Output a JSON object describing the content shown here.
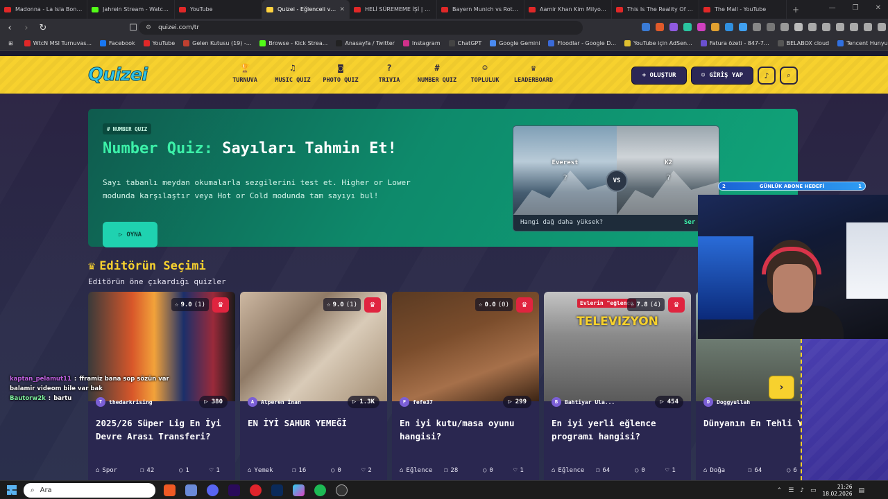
{
  "browser": {
    "tabs": [
      {
        "title": "Madonna - La Isla Bonita",
        "fav": "youtube",
        "active": false
      },
      {
        "title": "Jahrein Stream - Watch Li",
        "fav": "kick",
        "active": false
      },
      {
        "title": "YouTube",
        "fav": "youtube",
        "active": false
      },
      {
        "title": "Quizei - Eğlenceli ve e",
        "fav": "quizei",
        "active": true
      },
      {
        "title": "HELİ SÜREMEME İŞİ | SQU",
        "fav": "youtube",
        "active": false
      },
      {
        "title": "Bayern Munich vs Rottach",
        "fav": "youtube",
        "active": false
      },
      {
        "title": "Aamir Khan Kim Milyoner",
        "fav": "youtube",
        "active": false
      },
      {
        "title": "This Is The Reality Of Mod",
        "fav": "youtube",
        "active": false
      },
      {
        "title": "The Mall - YouTube",
        "fav": "youtube",
        "active": false
      }
    ],
    "url": "quizei.com/tr",
    "bookmarks": [
      "WtcN MSI Turnuvas...",
      "Facebook",
      "YouTube",
      "Gelen Kutusu (19) -...",
      "Browse - Kick Strea...",
      "Anasayfa / Twitter",
      "Instagram",
      "ChatGPT",
      "Google Gemini",
      "Floodlar - Google D...",
      "YouTube için AdSen...",
      "Fatura özeti - 847-7...",
      "BELABOX cloud",
      "Tencent Hunyuan 3D"
    ]
  },
  "site": {
    "logo": "Quizei",
    "nav": [
      {
        "label": "TURNUVA",
        "icon": "trophy-icon",
        "glyph": "🏆"
      },
      {
        "label": "MUSIC QUIZ",
        "icon": "music-icon",
        "glyph": "♫"
      },
      {
        "label": "PHOTO QUIZ",
        "icon": "camera-icon",
        "glyph": "◙"
      },
      {
        "label": "TRIVIA",
        "icon": "question-icon",
        "glyph": "?"
      },
      {
        "label": "NUMBER QUIZ",
        "icon": "hash-icon",
        "glyph": "#"
      },
      {
        "label": "TOPLULUK",
        "icon": "users-icon",
        "glyph": "☺"
      },
      {
        "label": "LEADERBOARD",
        "icon": "award-icon",
        "glyph": "♛"
      }
    ],
    "create_label": "+ OLUŞTUR",
    "login_label": "GİRİŞ YAP"
  },
  "hero": {
    "chip": "NUMBER QUIZ",
    "title_highlight": "Number Quiz:",
    "title_rest": " Sayıları Tahmin Et!",
    "description": "Sayı tabanlı meydan okumalarla sezgilerini test et. Higher or Lower modunda karşılaştır veya Hot or Cold modunda tam sayıyı bul!",
    "play_label": "OYNA",
    "compare": {
      "left_name": "Everest",
      "right_name": "K2",
      "left_value": "?",
      "right_value": "?",
      "vs": "VS",
      "question": "Hangi dağ daha yüksek?",
      "more": "Ser"
    }
  },
  "editors": {
    "title": "Editörün Seçimi",
    "subtitle": "Editörün öne çıkardığı quizler",
    "cards": [
      {
        "title": "2025/26 Süper Lig En İyi Devre Arası Transferi?",
        "author": "thedarkrising",
        "avatar": "T",
        "plays": "380",
        "rating": "9.0",
        "rating_count": "(1)",
        "category": "Spor",
        "questions": "42",
        "comments": "1",
        "likes": "1",
        "badge": ""
      },
      {
        "title": "EN İYİ SAHUR YEMEĞİ",
        "author": "Alperen İnan",
        "avatar": "A",
        "plays": "1.3K",
        "rating": "9.0",
        "rating_count": "(1)",
        "category": "Yemek",
        "questions": "16",
        "comments": "0",
        "likes": "2",
        "badge": ""
      },
      {
        "title": "En iyi kutu/masa oyunu hangisi?",
        "author": "fefe37",
        "avatar": "F",
        "plays": "299",
        "rating": "0.0",
        "rating_count": "(0)",
        "category": "Eğlence",
        "questions": "28",
        "comments": "0",
        "likes": "1",
        "badge": ""
      },
      {
        "title": "En iyi yerli eğlence programı hangisi?",
        "author": "Bahtiyar Ula...",
        "avatar": "B",
        "plays": "454",
        "rating": "7.8",
        "rating_count": "(4)",
        "category": "Eğlence",
        "questions": "64",
        "comments": "0",
        "likes": "1",
        "badge": "Evlerin \"eğlence",
        "image_text": "TELEVIZYON"
      },
      {
        "title": "Dünyanın En Tehli Yolları",
        "author": "Doggyullah",
        "avatar": "D",
        "plays": "",
        "rating": "",
        "rating_count": "",
        "category": "Doğa",
        "questions": "64",
        "comments": "6",
        "likes": "",
        "badge": ""
      }
    ]
  },
  "stream_overlay": {
    "goal_label": "GÜNLÜK ABONE HEDEFİ",
    "goal_current": "2",
    "goal_target": "1",
    "chat": [
      {
        "user": "kaptan_pelamut11",
        "message": "fframiz bana sop sözün var"
      },
      {
        "user": "",
        "message": "balamir videom bile var bak"
      },
      {
        "user": "Bautorw2k",
        "message": "bartu"
      }
    ]
  },
  "taskbar": {
    "search_placeholder": "Ara",
    "time": "21:26",
    "date": "18.02.2026"
  },
  "colors": {
    "site_yellow": "#f7d12e",
    "hero_green": "#10a57a",
    "accent_mint": "#3cf0a8",
    "card_bg": "#2a2750",
    "crown_red": "#e0243f"
  }
}
